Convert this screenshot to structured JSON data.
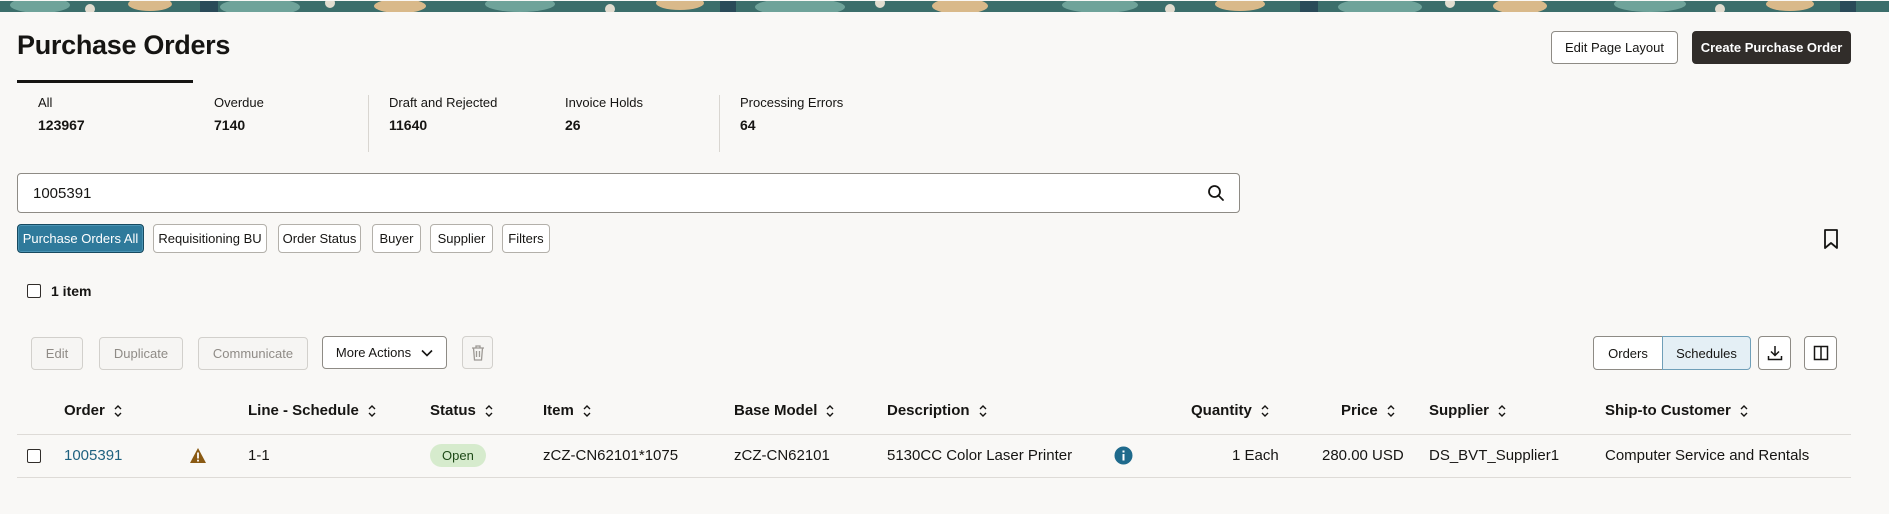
{
  "header": {
    "title": "Purchase Orders",
    "edit_layout_label": "Edit Page Layout",
    "create_label": "Create Purchase Order"
  },
  "kpis": [
    {
      "label": "All",
      "value": "123967"
    },
    {
      "label": "Overdue",
      "value": "7140"
    },
    {
      "label": "Draft and Rejected",
      "value": "11640"
    },
    {
      "label": "Invoice Holds",
      "value": "26"
    },
    {
      "label": "Processing Errors",
      "value": "64"
    }
  ],
  "search": {
    "value": "1005391"
  },
  "filters": [
    {
      "label": "Purchase Orders All",
      "active": true
    },
    {
      "label": "Requisitioning BU"
    },
    {
      "label": "Order Status"
    },
    {
      "label": "Buyer"
    },
    {
      "label": "Supplier"
    },
    {
      "label": "Filters"
    }
  ],
  "results": {
    "count_label": "1 item"
  },
  "toolbar": {
    "edit": "Edit",
    "duplicate": "Duplicate",
    "communicate": "Communicate",
    "more_actions": "More Actions",
    "view_orders": "Orders",
    "view_schedules": "Schedules",
    "selected_view": "Schedules"
  },
  "table": {
    "columns": [
      "Order",
      "Line - Schedule",
      "Status",
      "Item",
      "Base Model",
      "Description",
      "Quantity",
      "Price",
      "Supplier",
      "Ship-to Customer"
    ],
    "rows": [
      {
        "order": "1005391",
        "line_schedule": "1-1",
        "status": "Open",
        "item": "zCZ-CN62101*1075",
        "base_model": "zCZ-CN62101",
        "description": "5130CC Color Laser Printer",
        "quantity": "1 Each",
        "price": "280.00 USD",
        "supplier": "DS_BVT_Supplier1",
        "ship_to_customer": "Computer Service and Rentals"
      }
    ]
  },
  "colors": {
    "accent": "#2f7a9b",
    "link": "#1f6280",
    "primary_button": "#312d2a",
    "status_open_bg": "#d6ebcd",
    "warning": "#8a5a13",
    "info": "#1f6a8c"
  },
  "icons": [
    "search-icon",
    "bookmark-icon",
    "chevron-down-icon",
    "trash-icon",
    "download-icon",
    "columns-icon",
    "warning-icon",
    "info-icon",
    "sort-icon"
  ]
}
